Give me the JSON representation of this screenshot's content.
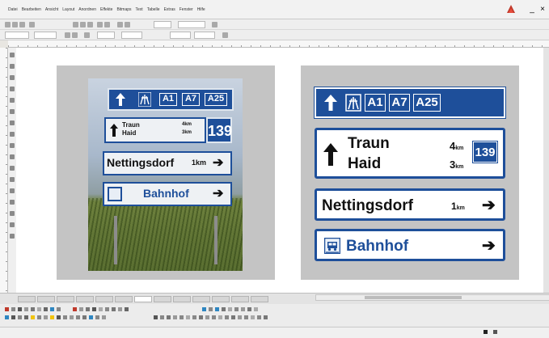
{
  "window": {
    "menu": [
      "Datei",
      "Bearbeiten",
      "Ansicht",
      "Layout",
      "Anordnen",
      "Effekte",
      "Bitmaps",
      "Text",
      "Tabelle",
      "Extras",
      "Fenster",
      "Hilfe"
    ],
    "minimize_glyph": "_",
    "close_glyph": "×"
  },
  "photo": {
    "motorway_boxes": [
      "A1",
      "A7",
      "A25"
    ],
    "direction": {
      "places": [
        "Traun",
        "Haid"
      ],
      "distances": [
        "4km",
        "3km"
      ],
      "route": "139"
    },
    "nettingsdorf": {
      "place": "Nettingsdorf",
      "distance": "1km",
      "arrow": "➔"
    },
    "bahnhof": {
      "place": "Bahnhof",
      "arrow": "➔"
    }
  },
  "sign": {
    "motorway_boxes": [
      "A1",
      "A7",
      "A25"
    ],
    "up_arrow": "🡅",
    "direction": {
      "places": [
        "Traun",
        "Haid"
      ],
      "distances": [
        "4",
        "3"
      ],
      "km_unit": "km",
      "route": "139",
      "arrow": "🡅"
    },
    "nettingsdorf": {
      "place": "Nettingsdorf",
      "distance": "1",
      "km_unit": "km",
      "arrow": "➔"
    },
    "bahnhof": {
      "place": "Bahnhof",
      "arrow": "➔"
    }
  },
  "colors": {
    "sign_blue": "#1e4f9a",
    "panel_grey": "#c4c4c4",
    "canvas_white": "#ffffff"
  },
  "icons": [
    "motorway-icon",
    "bus-icon",
    "arrow-up-icon",
    "arrow-right-icon",
    "logo-icon"
  ]
}
